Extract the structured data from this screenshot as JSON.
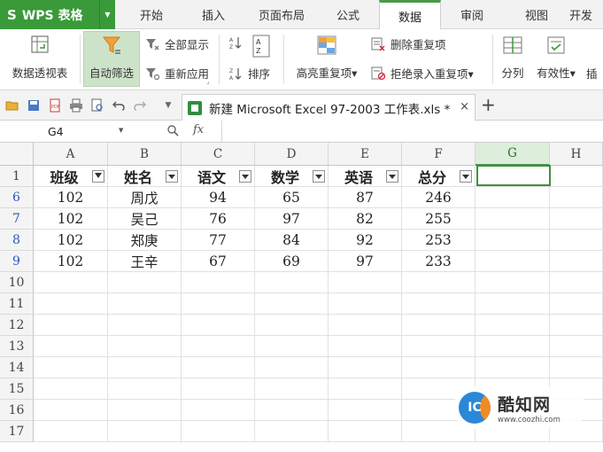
{
  "app": {
    "logo_glyph": "S",
    "title": "WPS 表格",
    "dropdown_glyph": "▼"
  },
  "menu_tabs": [
    {
      "label": "开始",
      "active": false
    },
    {
      "label": "插入",
      "active": false
    },
    {
      "label": "页面布局",
      "active": false
    },
    {
      "label": "公式",
      "active": false
    },
    {
      "label": "数据",
      "active": true
    },
    {
      "label": "审阅",
      "active": false
    },
    {
      "label": "视图",
      "active": false
    },
    {
      "label": "开发",
      "active": false
    }
  ],
  "ribbon": {
    "pivot_table": "数据透视表",
    "auto_filter": "自动筛选",
    "show_all": "全部显示",
    "reapply": "重新应用",
    "sort": "排序",
    "highlight_duplicates": "高亮重复项",
    "delete_duplicates": "删除重复项",
    "reject_duplicates": "拒绝录入重复项",
    "split_column": "分列",
    "validity": "有效性",
    "insert": "插",
    "dropdown_glyph": "▾",
    "expand_glyph": "⌟"
  },
  "doc_tab": {
    "title": "新建 Microsoft Excel 97-2003 工作表.xls *",
    "close_glyph": "×",
    "add_glyph": "+"
  },
  "formula_bar": {
    "cell_ref": "G4",
    "fx": "fx",
    "value": ""
  },
  "grid": {
    "columns": [
      "A",
      "B",
      "C",
      "D",
      "E",
      "F",
      "G",
      "H"
    ],
    "selected_column": "G",
    "header_row_number": "1",
    "headers": [
      "班级",
      "姓名",
      "语文",
      "数学",
      "英语",
      "总分"
    ],
    "active_filter_column": 0,
    "rows": [
      {
        "row": "6",
        "cells": [
          "102",
          "周戊",
          "94",
          "65",
          "87",
          "246"
        ]
      },
      {
        "row": "7",
        "cells": [
          "102",
          "吴己",
          "76",
          "97",
          "82",
          "255"
        ]
      },
      {
        "row": "8",
        "cells": [
          "102",
          "郑庚",
          "77",
          "84",
          "92",
          "253"
        ]
      },
      {
        "row": "9",
        "cells": [
          "102",
          "王辛",
          "67",
          "69",
          "97",
          "233"
        ]
      }
    ],
    "empty_rows": [
      "10",
      "11",
      "12",
      "13",
      "14",
      "15",
      "16",
      "17"
    ]
  },
  "watermark": {
    "logo_text": "IC",
    "title": "酷知网",
    "url": "www.coozhi.com"
  },
  "colors": {
    "accent_green": "#3a9a3a",
    "filtered_row_number": "#2a55c6"
  }
}
